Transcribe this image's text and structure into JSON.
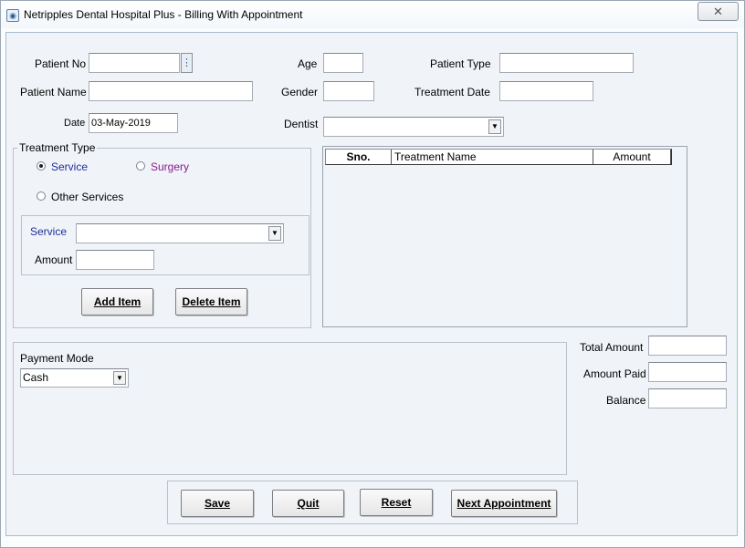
{
  "window": {
    "title": "Netripples Dental Hospital Plus - Billing With Appointment",
    "close_glyph": "✕"
  },
  "patient": {
    "patient_no_label": "Patient No",
    "patient_no_value": "",
    "lookup_glyph": "⋮",
    "patient_name_label": "Patient Name",
    "patient_name_value": "",
    "date_label": "Date",
    "date_value": "03-May-2019",
    "age_label": "Age",
    "age_value": "",
    "gender_label": "Gender",
    "gender_value": "",
    "dentist_label": "Dentist",
    "dentist_value": "",
    "patient_type_label": "Patient Type",
    "patient_type_value": "",
    "treatment_date_label": "Treatment Date",
    "treatment_date_value": ""
  },
  "treatment_type": {
    "group_label": "Treatment Type",
    "options": [
      {
        "label": "Service",
        "checked": true
      },
      {
        "label": "Surgery",
        "checked": false
      },
      {
        "label": "Other Services",
        "checked": false
      }
    ],
    "service_label": "Service",
    "service_value": "",
    "amount_label": "Amount",
    "amount_value": "",
    "add_item": "Add Item",
    "delete_item": "Delete Item"
  },
  "items_grid": {
    "columns": [
      "Sno.",
      "Treatment Name",
      "Amount"
    ],
    "rows": []
  },
  "payment": {
    "label": "Payment Mode",
    "selected": "Cash"
  },
  "totals": {
    "total_amount_label": "Total Amount",
    "total_amount_value": "",
    "amount_paid_label": "Amount Paid",
    "amount_paid_value": "",
    "balance_label": "Balance",
    "balance_value": ""
  },
  "actions": {
    "save": "Save",
    "quit": "Quit",
    "reset": "Reset",
    "next_appointment": "Next Appointment"
  },
  "icons": {
    "app_icon": "tooth-icon",
    "combo_arrow": "▼"
  },
  "colors": {
    "form_background": "#f0f4f9",
    "service_label_blue": "#1f2d9b",
    "surgery_label_purple": "#8a1a8a"
  }
}
